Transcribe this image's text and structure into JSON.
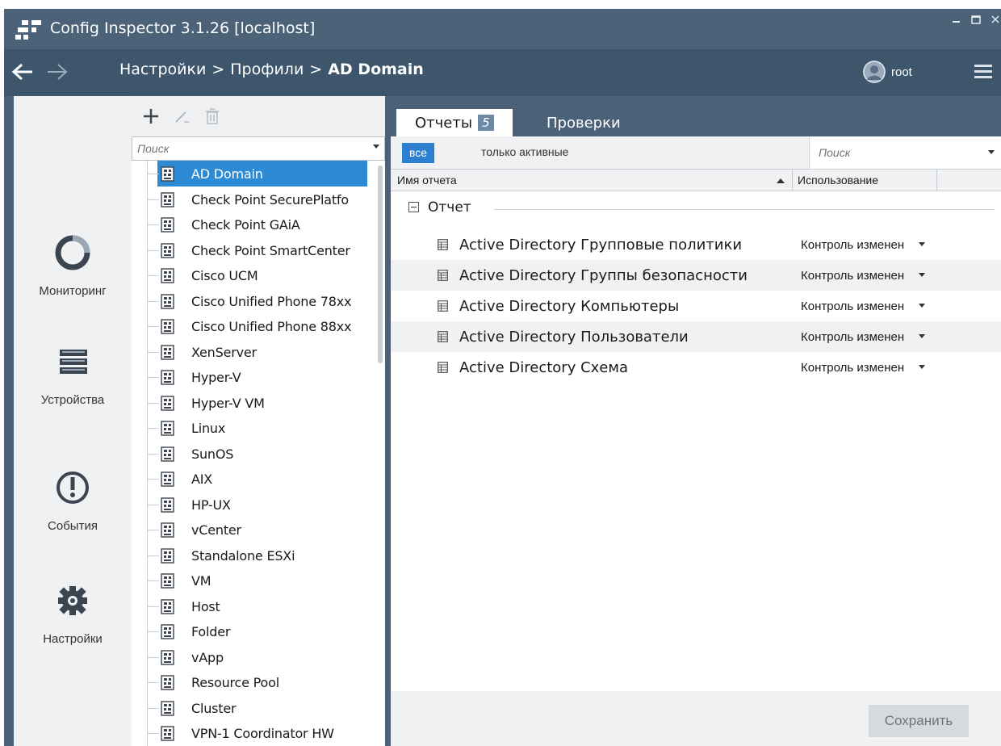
{
  "window": {
    "title": "Config Inspector 3.1.26 [localhost]"
  },
  "nav": {
    "breadcrumb": [
      "Настройки",
      "Профили",
      "AD Domain"
    ],
    "separator": ">",
    "user": "root"
  },
  "leftnav": {
    "items": [
      {
        "label": "Мониторинг",
        "icon": "monitoring-icon"
      },
      {
        "label": "Устройства",
        "icon": "devices-icon"
      },
      {
        "label": "События",
        "icon": "events-icon"
      },
      {
        "label": "Настройки",
        "icon": "settings-gear-icon"
      }
    ]
  },
  "profiles": {
    "search_placeholder": "Поиск",
    "items": [
      "AD Domain",
      "Check Point SecurePlatfo",
      "Check Point GAiA",
      "Check Point SmartCenter",
      "Cisco UCM",
      "Cisco Unified Phone 78xx",
      "Cisco Unified Phone 88xx",
      "XenServer",
      "Hyper-V",
      "Hyper-V VM",
      "Linux",
      "SunOS",
      "AIX",
      "HP-UX",
      "vCenter",
      "Standalone ESXi",
      "VM",
      "Host",
      "Folder",
      "vApp",
      "Resource Pool",
      "Cluster",
      "VPN-1 Coordinator HW"
    ],
    "selected_index": 0
  },
  "content": {
    "tabs": [
      {
        "label": "Отчеты",
        "badge": "5"
      },
      {
        "label": "Проверки"
      }
    ],
    "filters": {
      "all": "все",
      "active_only": "только активные",
      "search_placeholder": "Поиск"
    },
    "columns": {
      "name": "Имя отчета",
      "usage": "Использование"
    },
    "group": {
      "label": "Отчет"
    },
    "reports": [
      {
        "name": "Active Directory Групповые политики",
        "usage": "Контроль изменений"
      },
      {
        "name": "Active Directory Группы безопасности",
        "usage": "Контроль изменений"
      },
      {
        "name": "Active Directory Компьютеры",
        "usage": "Контроль изменений"
      },
      {
        "name": "Active Directory Пользователи",
        "usage": "Контроль изменений"
      },
      {
        "name": "Active Directory Схема",
        "usage": "Контроль изменений"
      }
    ],
    "save_label": "Сохранить"
  },
  "colors": {
    "titlebar": "#4b6278",
    "navbar": "#3e566c",
    "accent": "#2d8bd6",
    "panel": "#eff1f3"
  }
}
